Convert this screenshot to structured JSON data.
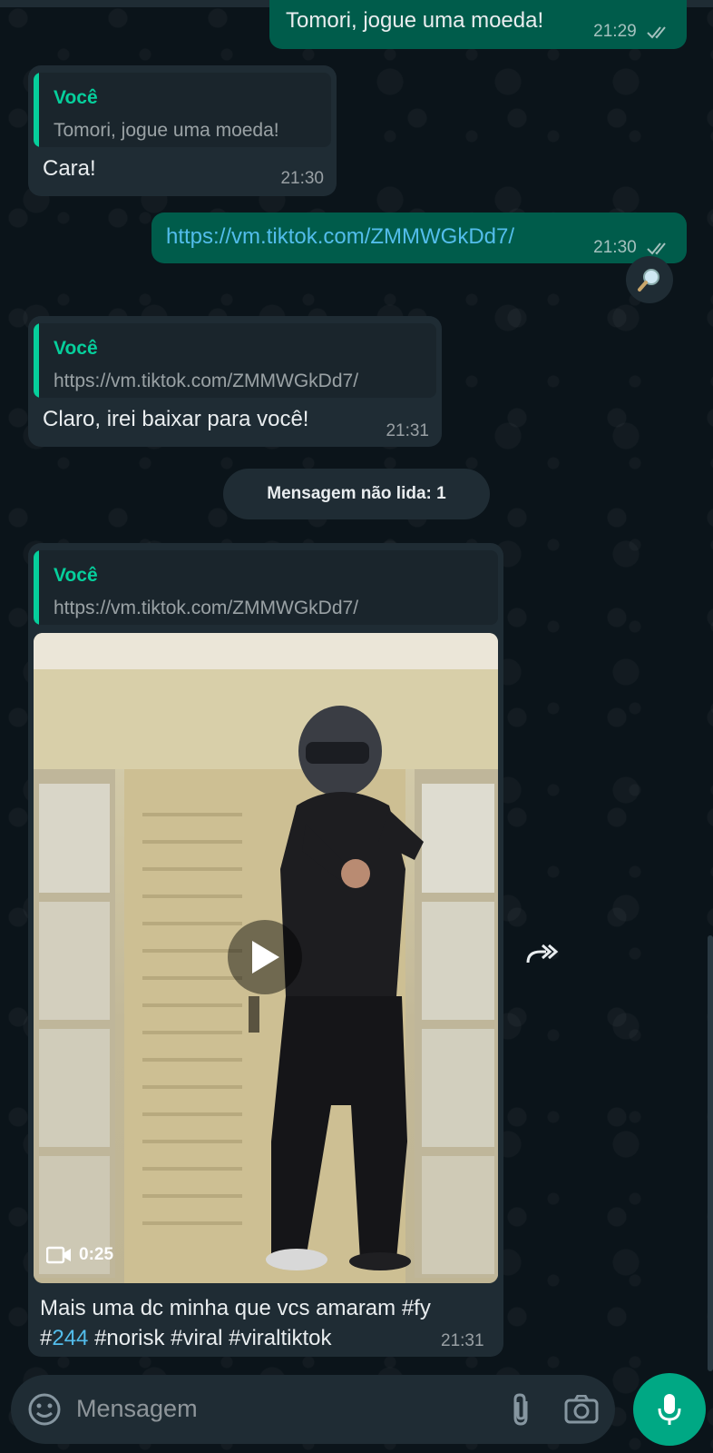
{
  "messages": [
    {
      "id": "m1",
      "direction": "out",
      "text": "Tomori, jogue uma moeda!",
      "time": "21:29",
      "status": "read"
    },
    {
      "id": "m2",
      "direction": "in",
      "quote": {
        "author": "Você",
        "text": "Tomori, jogue uma moeda!"
      },
      "text": "Cara!",
      "time": "21:30"
    },
    {
      "id": "m3",
      "direction": "out",
      "text": "https://vm.tiktok.com/ZMMWGkDd7/",
      "time": "21:30",
      "status": "read"
    },
    {
      "id": "m4",
      "direction": "in",
      "quote": {
        "author": "Você",
        "text": "https://vm.tiktok.com/ZMMWGkDd7/"
      },
      "text": "Claro, irei baixar para você!",
      "time": "21:31"
    },
    {
      "id": "m5",
      "direction": "in",
      "quote": {
        "author": "Você",
        "text": "https://vm.tiktok.com/ZMMWGkDd7/"
      },
      "video": {
        "duration": "0:25"
      },
      "caption_pre": "Mais uma dc minha que vcs amaram #fy",
      "caption_hash_num": "#",
      "caption_link": "244",
      "caption_post": " #norisk #viral #viraltiktok",
      "time": "21:31"
    }
  ],
  "unread_label": "Mensagem não lida: 1",
  "composer": {
    "placeholder": "Mensagem"
  },
  "colors": {
    "outgoing": "#005c4b",
    "incoming": "#1f2c34",
    "accent": "#00a884",
    "quote_author": "#06cf9c",
    "link": "#53bdeb"
  },
  "icons": {
    "search": "magnifier-icon",
    "forward": "forward-icon",
    "emoji": "emoji-icon",
    "attach": "paperclip-icon",
    "camera": "camera-icon",
    "mic": "mic-icon",
    "play": "play-icon",
    "video": "video-camera-icon",
    "read": "double-check-icon"
  }
}
